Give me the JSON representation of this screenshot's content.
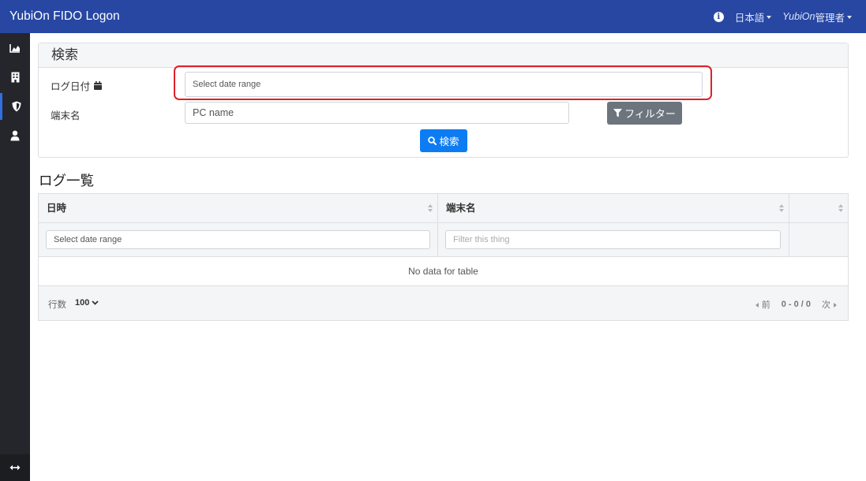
{
  "app": {
    "title": "YubiOn FIDO Logon"
  },
  "navbar": {
    "language_label": "日本語",
    "user_italic": "YubiOn",
    "user_suffix": "管理者"
  },
  "sidebar": {
    "items": [
      {
        "icon": "chart-area-icon",
        "active": false
      },
      {
        "icon": "building-icon",
        "active": false
      },
      {
        "icon": "shield-icon",
        "active": true
      },
      {
        "icon": "user-icon",
        "active": false
      }
    ],
    "bottom_icon": "arrows-horizontal-icon"
  },
  "search": {
    "title": "検索",
    "log_date_label": "ログ日付",
    "date_placeholder": "Select date range",
    "pc_label": "端末名",
    "pc_placeholder": "PC name",
    "filter_button": "フィルター",
    "search_button": "検索"
  },
  "log_list": {
    "title": "ログ一覧",
    "columns": [
      "日時",
      "端末名",
      ""
    ],
    "date_filter_placeholder": "Select date range",
    "pc_filter_placeholder": "Filter this thing",
    "empty_text": "No data for table",
    "footer": {
      "rows_label": "行数",
      "rows_value": "100",
      "prev_label": "前",
      "page_info": "0 - 0 / 0",
      "next_label": "次"
    }
  },
  "colors": {
    "navbar": "#2747a3",
    "sidebar": "#24262b",
    "primary_button": "#0d7cf2",
    "secondary_button": "#6c757d",
    "highlight": "#e0202a"
  }
}
